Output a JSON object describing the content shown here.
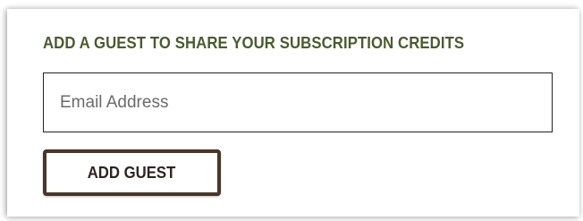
{
  "guest_form": {
    "heading": "ADD A GUEST TO SHARE YOUR SUBSCRIPTION CREDITS",
    "email_placeholder": "Email Address",
    "email_value": "",
    "add_button_label": "ADD GUEST"
  },
  "colors": {
    "heading": "#4a5b2f",
    "button_border": "#4a3528",
    "input_border": "#222222"
  }
}
